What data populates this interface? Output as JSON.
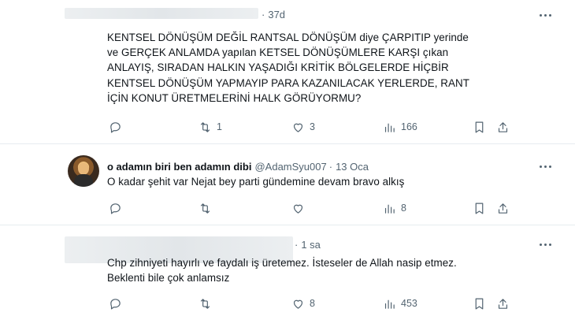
{
  "tweets": [
    {
      "name": "",
      "handle": "",
      "time": "37d",
      "text_lines": [
        "KENTSEL DÖNÜŞÜM DEĞİL RANTSAL DÖNÜŞÜM diye ÇARPITIP yerinde",
        "ve GERÇEK ANLAMDA yapılan KETSEL DÖNÜŞÜMLERE KARŞI çıkan",
        "ANLAYIŞ, SIRADAN HALKIN YAŞADIĞI KRİTİK BÖLGELERDE HİÇBİR",
        "KENTSEL DÖNÜŞÜM YAPMAYIP PARA KAZANILACAK YERLERDE, RANT",
        "İÇİN KONUT ÜRETMELERİNİ HALK GÖRÜYORMU?"
      ],
      "replies": "",
      "retweets": "1",
      "likes": "3",
      "views": "166"
    },
    {
      "name": "o adamın biri ben adamın dibi",
      "handle": "@AdamSyu007",
      "dot": "·",
      "time": "13 Oca",
      "text_lines": [
        "O kadar şehit var Nejat bey parti gündemine devam bravo alkış"
      ],
      "replies": "",
      "retweets": "",
      "likes": "",
      "views": "8"
    },
    {
      "name": "",
      "handle": "",
      "time": "1 sa",
      "text_lines": [
        "Chp zihniyeti hayırlı ve faydalı iş üretemez. İsteseler de Allah nasip etmez.",
        "Beklenti bile çok anlamsız"
      ],
      "replies": "",
      "retweets": "",
      "likes": "8",
      "views": "453"
    }
  ],
  "icons": {
    "reply": "reply-icon",
    "retweet": "retweet-icon",
    "like": "heart-icon",
    "views": "views-icon",
    "bookmark": "bookmark-icon",
    "share": "share-icon",
    "more": "more-icon"
  },
  "colors": {
    "text": "#0f1419",
    "muted": "#536471",
    "divider": "#e6ecf0"
  }
}
